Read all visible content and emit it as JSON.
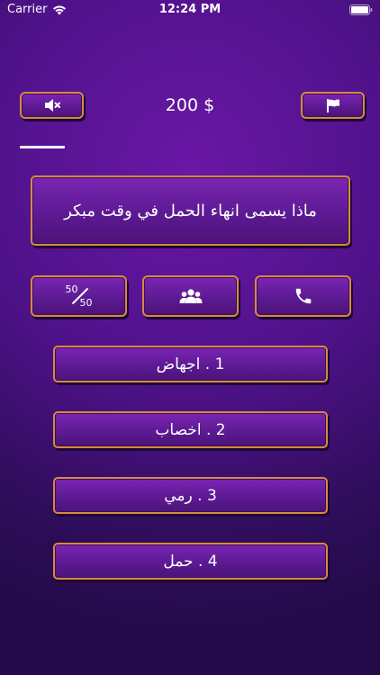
{
  "status_bar": {
    "carrier": "Carrier",
    "time": "12:24 PM"
  },
  "header": {
    "score": "200 $"
  },
  "question": {
    "text": "ماذا يسمى انهاء الحمل في وقت مبكر"
  },
  "lifelines": {
    "fifty_top": "50",
    "fifty_bottom": "50"
  },
  "answers": [
    {
      "label": "1 . اجهاض"
    },
    {
      "label": "2 . اخصاب"
    },
    {
      "label": "3 . رمي"
    },
    {
      "label": "4 . حمل"
    }
  ],
  "colors": {
    "accent_border": "#d98a3a",
    "panel": "#6a1fa3",
    "background": "#4f128a"
  },
  "icons": [
    "wifi-icon",
    "battery-icon",
    "mute-icon",
    "flag-icon",
    "audience-icon",
    "phone-icon"
  ]
}
